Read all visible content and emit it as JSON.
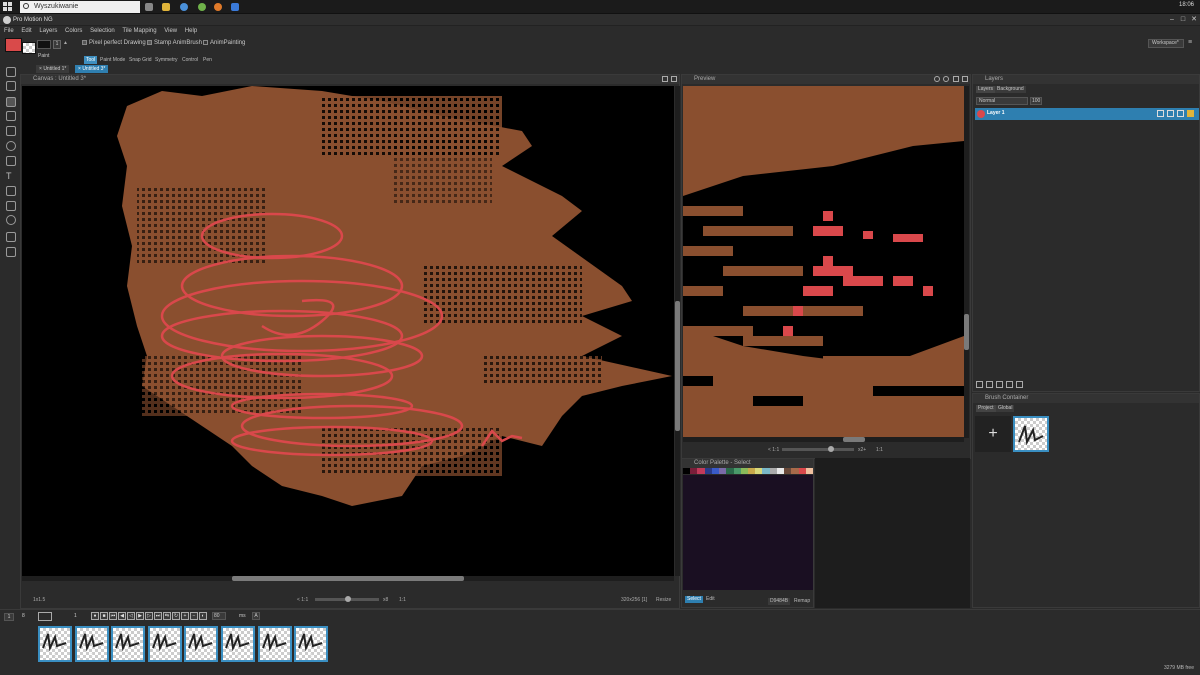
{
  "taskbar": {
    "search_placeholder": "Wyszukiwanie",
    "clock": "18:06"
  },
  "app": {
    "title": "Pro Motion NG",
    "window_controls": [
      "–",
      "□",
      "✕"
    ]
  },
  "menu": [
    "File",
    "Edit",
    "Layers",
    "Colors",
    "Selection",
    "Tile Mapping",
    "View",
    "Help"
  ],
  "options": {
    "brush_size": "1",
    "paint_label": "Paint",
    "pixel_perfect": "Pixel perfect Drawing",
    "stamp_animbrush": "Stamp AnimBrush",
    "animpainting": "AnimPainting",
    "workspace": "Workspace*"
  },
  "subtabs": [
    "Tool",
    "Paint Mode",
    "Snap Grid",
    "Symmetry",
    "Control",
    "Pen"
  ],
  "doc_tabs": [
    "Untitled 1*",
    "Untitled 3*"
  ],
  "canvas": {
    "title": "Canvas : Untitled 3*",
    "zoom_left": "1x1.5",
    "zoom_ratio": "< 1:1",
    "zoom_mult": "x8",
    "zoom_fit": "1:1",
    "size": "320x256 [1]",
    "resize": "Resize"
  },
  "preview": {
    "title": "Preview",
    "zoom_ratio": "< 1:1",
    "zoom_mult": "x2+",
    "zoom_fit": "1:1"
  },
  "palette": {
    "title": "Color Palette - Select",
    "tab_select": "Select",
    "tab_edit": "Edit",
    "hex": "D9484B",
    "remap": "Remap",
    "colors": [
      "#000000",
      "#7a1e3a",
      "#c23a5a",
      "#2a3a8a",
      "#3a5ac8",
      "#7a6aa8",
      "#2a6a4a",
      "#4a9a6a",
      "#8aba5a",
      "#c8a84a",
      "#d8d87a",
      "#7ab8c8",
      "#aaaaaa",
      "#e8e8e8",
      "#6a4a3a",
      "#a86a4a",
      "#d9484b",
      "#f0c0a0"
    ]
  },
  "layers": {
    "title": "Layers",
    "tabs": [
      "Layers",
      "Background"
    ],
    "blend": "Normal",
    "opacity": "100",
    "layer_name": "Layer 1"
  },
  "brush": {
    "title": "Brush Container",
    "tabs": [
      "Project",
      "Global"
    ],
    "add": "+"
  },
  "timeline": {
    "frame_count": "8",
    "frame_index": "1",
    "loop_label": "1",
    "fps": "80",
    "ms": "ms",
    "frames": [
      "1",
      "2",
      "3",
      "4",
      "5",
      "6",
      "7",
      "8"
    ],
    "memory": "3279 MB free"
  },
  "colors": {
    "brown": "#8a4f2f",
    "red_stroke": "#d9484b",
    "accent_blue": "#3a8fc2"
  }
}
